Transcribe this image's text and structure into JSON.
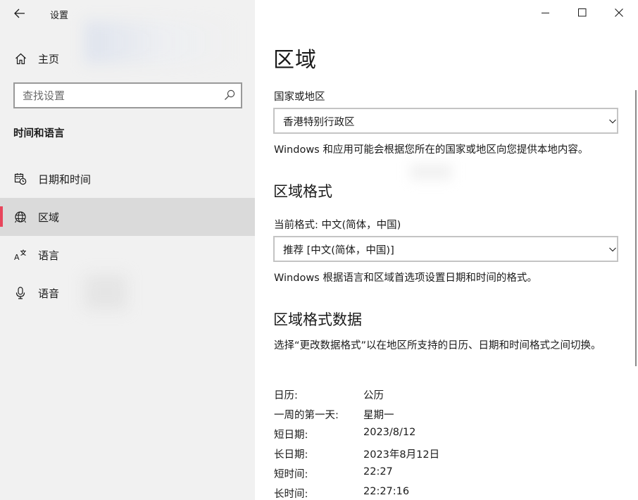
{
  "window": {
    "app_title": "设置",
    "back_icon": "back-arrow-icon",
    "controls": [
      "minimize-icon",
      "maximize-icon",
      "close-icon"
    ]
  },
  "sidebar": {
    "home_label": "主页",
    "home_icon": "home-icon",
    "search_placeholder": "查找设置",
    "section_title": "时间和语言",
    "items": [
      {
        "label": "日期和时间",
        "icon": "calendar-clock-icon",
        "selected": false
      },
      {
        "label": "区域",
        "icon": "globe-icon",
        "selected": true
      },
      {
        "label": "语言",
        "icon": "language-icon",
        "selected": false
      },
      {
        "label": "语音",
        "icon": "microphone-icon",
        "selected": false
      }
    ],
    "accent_color": "#e8455b"
  },
  "main": {
    "title": "区域",
    "country": {
      "label": "国家或地区",
      "value": "香港特别行政区",
      "description": "Windows 和应用可能会根据您所在的国家或地区向您提供本地内容。"
    },
    "format": {
      "heading": "区域格式",
      "current_label": "当前格式: 中文(简体，中国)",
      "value": "推荐 [中文(简体，中国)]",
      "description": "Windows 根据语言和区域首选项设置日期和时间的格式。"
    },
    "format_data": {
      "heading": "区域格式数据",
      "description": "选择“更改数据格式”以在地区所支持的日历、日期和时间格式之间切换。",
      "rows": [
        {
          "key": "日历:",
          "value": "公历"
        },
        {
          "key": "一周的第一天:",
          "value": "星期一"
        },
        {
          "key": "短日期:",
          "value": "2023/8/12"
        },
        {
          "key": "长日期:",
          "value": "2023年8月12日"
        },
        {
          "key": "短时间:",
          "value": "22:27"
        },
        {
          "key": "长时间:",
          "value": "22:27:16"
        }
      ]
    }
  }
}
